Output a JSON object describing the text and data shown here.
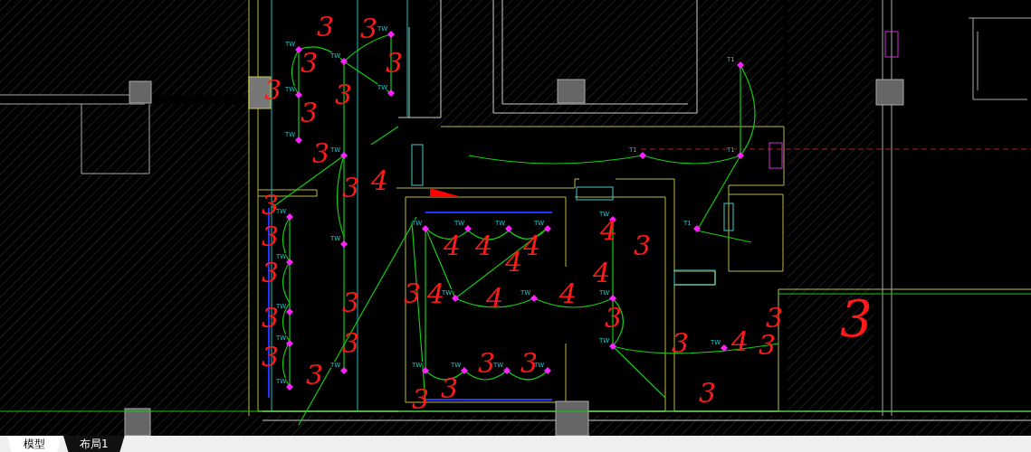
{
  "drawing": {
    "fixtures": [
      {
        "label": "TW"
      },
      {
        "label": "TW"
      },
      {
        "label": "TW"
      },
      {
        "label": "T1"
      },
      {
        "label": "TW"
      },
      {
        "label": "TW"
      },
      {
        "label": "TW"
      },
      {
        "label": "TW"
      },
      {
        "label": "T1"
      },
      {
        "label": "T1"
      },
      {
        "label": "TW"
      },
      {
        "label": "TW"
      },
      {
        "label": "TW"
      },
      {
        "label": "TW"
      },
      {
        "label": "TW"
      },
      {
        "label": "TW"
      },
      {
        "label": "T1"
      },
      {
        "label": "TW"
      },
      {
        "label": "TW"
      },
      {
        "label": "TW"
      },
      {
        "label": "TW"
      },
      {
        "label": "TW"
      },
      {
        "label": "TW"
      },
      {
        "label": "TW"
      },
      {
        "label": "TW"
      },
      {
        "label": "TW"
      },
      {
        "label": "TW"
      },
      {
        "label": "TW"
      },
      {
        "label": "TW"
      },
      {
        "label": "TW"
      },
      {
        "label": "TW"
      },
      {
        "label": "TW"
      }
    ],
    "markup_numbers": [
      "3",
      "3",
      "3",
      "3",
      "3",
      "3",
      "3",
      "3",
      "4",
      "3",
      "3",
      "3",
      "3",
      "3",
      "3",
      "3",
      "3",
      "3",
      "4",
      "4",
      "4",
      "4",
      "4",
      "4",
      "3",
      "3",
      "4",
      "4",
      "4",
      "3",
      "3",
      "3",
      "3",
      "3",
      "3",
      "3",
      "4",
      "3",
      "3",
      "3"
    ]
  },
  "tabs": [
    {
      "label": "模型",
      "selected": true
    },
    {
      "label": "布局1",
      "selected": false
    }
  ]
}
